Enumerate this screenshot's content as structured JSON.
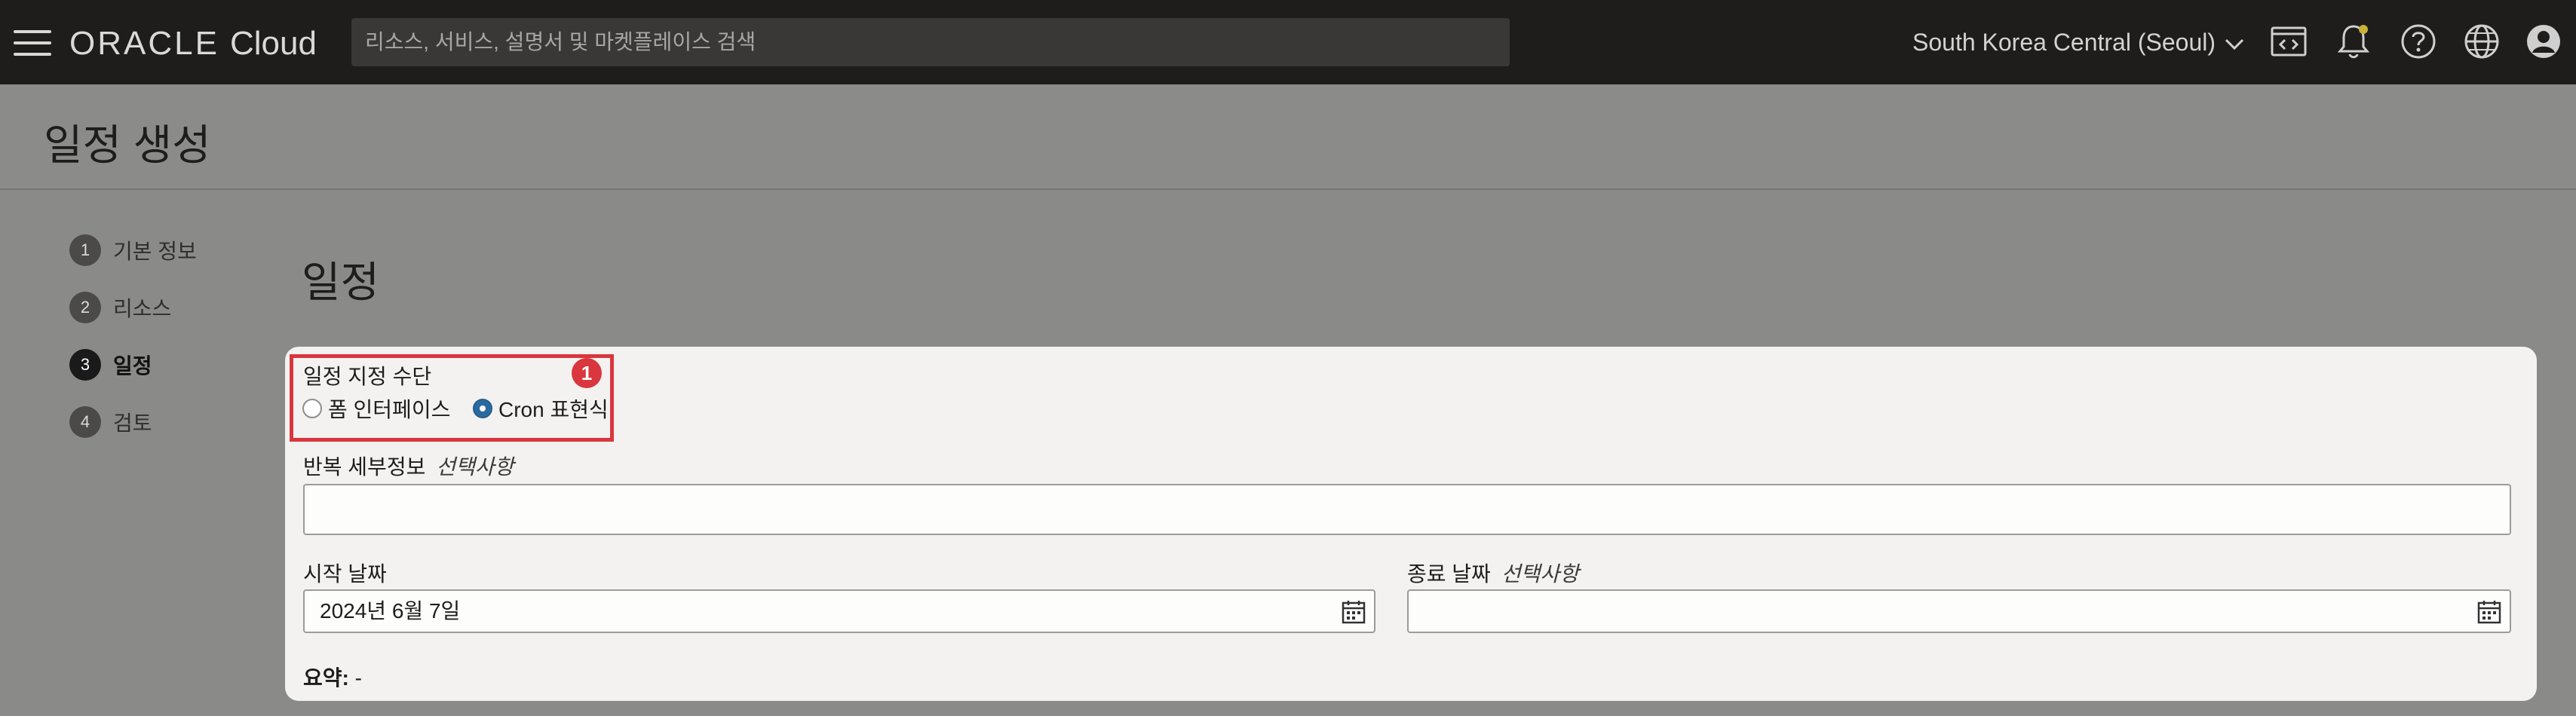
{
  "topbar": {
    "brand_oracle": "ORACLE",
    "brand_cloud": "Cloud",
    "search_placeholder": "리소스, 서비스, 설명서 및 마켓플레이스 검색",
    "region": "South Korea Central (Seoul)",
    "icons": [
      "menu-icon",
      "code-editor-icon",
      "notifications-bell-icon",
      "help-icon",
      "language-globe-icon",
      "user-profile-icon"
    ]
  },
  "page": {
    "title": "일정 생성"
  },
  "steps": [
    {
      "number": "1",
      "label": "기본 정보",
      "active": false
    },
    {
      "number": "2",
      "label": "리소스",
      "active": false
    },
    {
      "number": "3",
      "label": "일정",
      "active": true
    },
    {
      "number": "4",
      "label": "검토",
      "active": false
    }
  ],
  "section": {
    "title": "일정"
  },
  "form": {
    "schedule_method": {
      "label": "일정 지정 수단",
      "options": [
        "폼 인터페이스",
        "Cron 표현식"
      ],
      "selected": "Cron 표현식"
    },
    "callout_badge": "1",
    "recurrence": {
      "label": "반복 세부정보",
      "optional": "선택사항",
      "value": ""
    },
    "start_date": {
      "label": "시작 날짜",
      "value": "2024년 6월 7일"
    },
    "end_date": {
      "label": "종료 날짜",
      "optional": "선택사항",
      "value": ""
    },
    "summary": {
      "label": "요약:",
      "value": "-"
    }
  },
  "colors": {
    "highlight": "#d9363e",
    "radio_selected": "#2a6aa0",
    "topbar_bg": "#1f1d1b"
  }
}
